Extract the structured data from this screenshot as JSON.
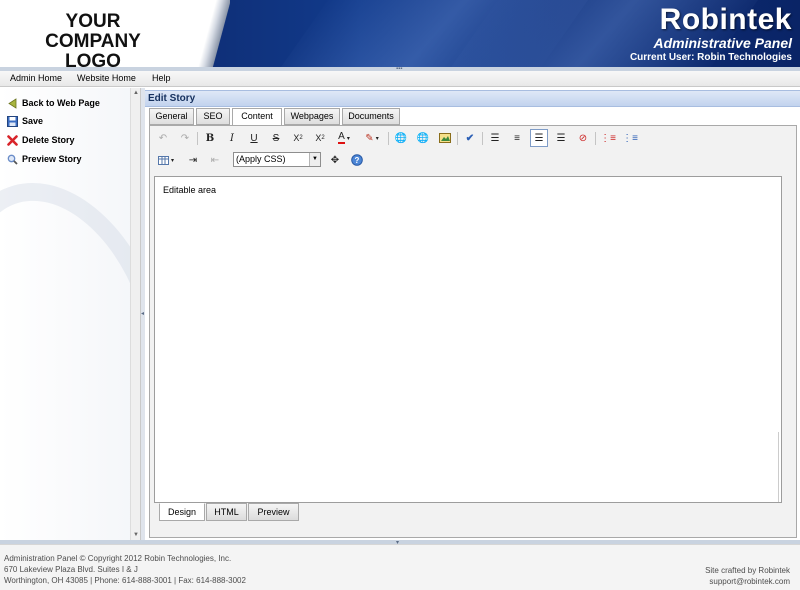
{
  "header": {
    "logo_line1": "YOUR",
    "logo_line2": "COMPANY LOGO",
    "brand_name": "Robintek",
    "brand_subtitle": "Administrative Panel",
    "current_user": "Current User: Robin Technologies"
  },
  "menu": {
    "items": [
      {
        "label": "Admin Home"
      },
      {
        "label": "Website Home"
      },
      {
        "label": "Help"
      }
    ]
  },
  "sidebar": {
    "items": [
      {
        "label": "Back to Web Page",
        "icon": "arrow-left-icon",
        "color": "#9aa83a"
      },
      {
        "label": "Save",
        "icon": "floppy-disk-icon",
        "color": "#3a6cc2"
      },
      {
        "label": "Delete Story",
        "icon": "red-x-icon",
        "color": "#d8242a"
      },
      {
        "label": "Preview Story",
        "icon": "magnifier-icon",
        "color": "#6a8cc8"
      }
    ]
  },
  "panel": {
    "title": "Edit Story",
    "tabs": [
      {
        "label": "General"
      },
      {
        "label": "SEO"
      },
      {
        "label": "Content"
      },
      {
        "label": "Webpages"
      },
      {
        "label": "Documents"
      }
    ],
    "active_tab": "Content"
  },
  "toolbar": {
    "css_select_value": "(Apply CSS)"
  },
  "editor": {
    "content": "Editable area",
    "mode_tabs": [
      {
        "label": "Design"
      },
      {
        "label": "HTML"
      },
      {
        "label": "Preview"
      }
    ],
    "active_mode": "Design"
  },
  "footer": {
    "line1": "Administration Panel © Copyright 2012 Robin Technologies, Inc.",
    "line2": "670 Lakeview Plaza Blvd. Suites I & J",
    "line3": "Worthington, OH 43085 | Phone: 614-888-3001 | Fax: 614-888-3002",
    "credit": "Site crafted by Robintek",
    "email": "support@robintek.com"
  },
  "colors": {
    "header_blue": "#123b8c",
    "panel_title_bg": "#c2d3ee"
  }
}
